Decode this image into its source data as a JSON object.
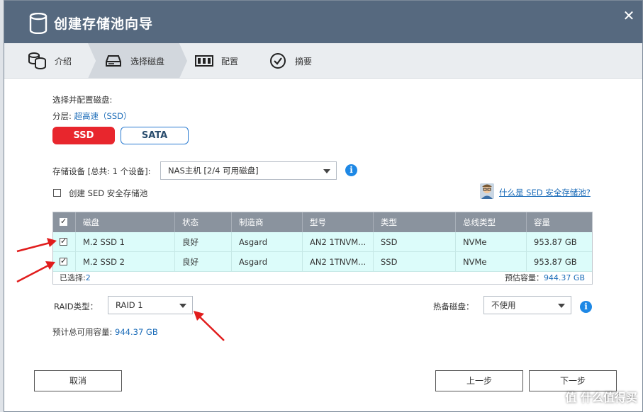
{
  "window": {
    "title": "创建存储池向导"
  },
  "steps": [
    {
      "label": "介绍",
      "icon": "database-stack-icon"
    },
    {
      "label": "选择磁盘",
      "icon": "disk-drive-icon"
    },
    {
      "label": "配置",
      "icon": "raid-config-icon"
    },
    {
      "label": "摘要",
      "icon": "checkmark-circle-icon"
    }
  ],
  "content": {
    "select_heading": "选择并配置磁盘:",
    "tier_prefix": "分层:",
    "tier_value": "超高速（SSD）",
    "type_buttons": {
      "ssd": "SSD",
      "sata": "SATA"
    },
    "storage_device_label": "存储设备 [总共: 1 个设备]:",
    "storage_device_value": "NAS主机 [2/4 可用磁盘]",
    "sed_checkbox_label": "创建 SED 安全存储池",
    "sed_help_link": "什么是 SED 安全存储池?"
  },
  "table": {
    "headers": [
      "磁盘",
      "状态",
      "制造商",
      "型号",
      "类型",
      "总线类型",
      "容量"
    ],
    "rows": [
      {
        "disk": "M.2 SSD 1",
        "status": "良好",
        "maker": "Asgard",
        "model": "AN2 1TNVM...",
        "type": "SSD",
        "bus": "NVMe",
        "capacity": "953.87 GB"
      },
      {
        "disk": "M.2 SSD 2",
        "status": "良好",
        "maker": "Asgard",
        "model": "AN2 1TNVM...",
        "type": "SSD",
        "bus": "NVMe",
        "capacity": "953.87 GB"
      }
    ],
    "selected_label": "已选择:",
    "selected_count": "2",
    "estimate_label": "预估容量：",
    "estimate_value": "944.37 GB"
  },
  "raid": {
    "label": "RAID类型：",
    "value": "RAID 1",
    "hot_spare_label": "热备磁盘：",
    "hot_spare_value": "不使用",
    "usable_label": "预计总可用容量:",
    "usable_value": "944.37 GB"
  },
  "buttons": {
    "cancel": "取消",
    "prev": "上一步",
    "next": "下一步"
  },
  "watermark": "值 什么值得买",
  "colors": {
    "titlebar": "#56697f",
    "accent_red": "#e8262d",
    "link_blue": "#1a6bb8",
    "row_selected": "#dcfcfa"
  }
}
